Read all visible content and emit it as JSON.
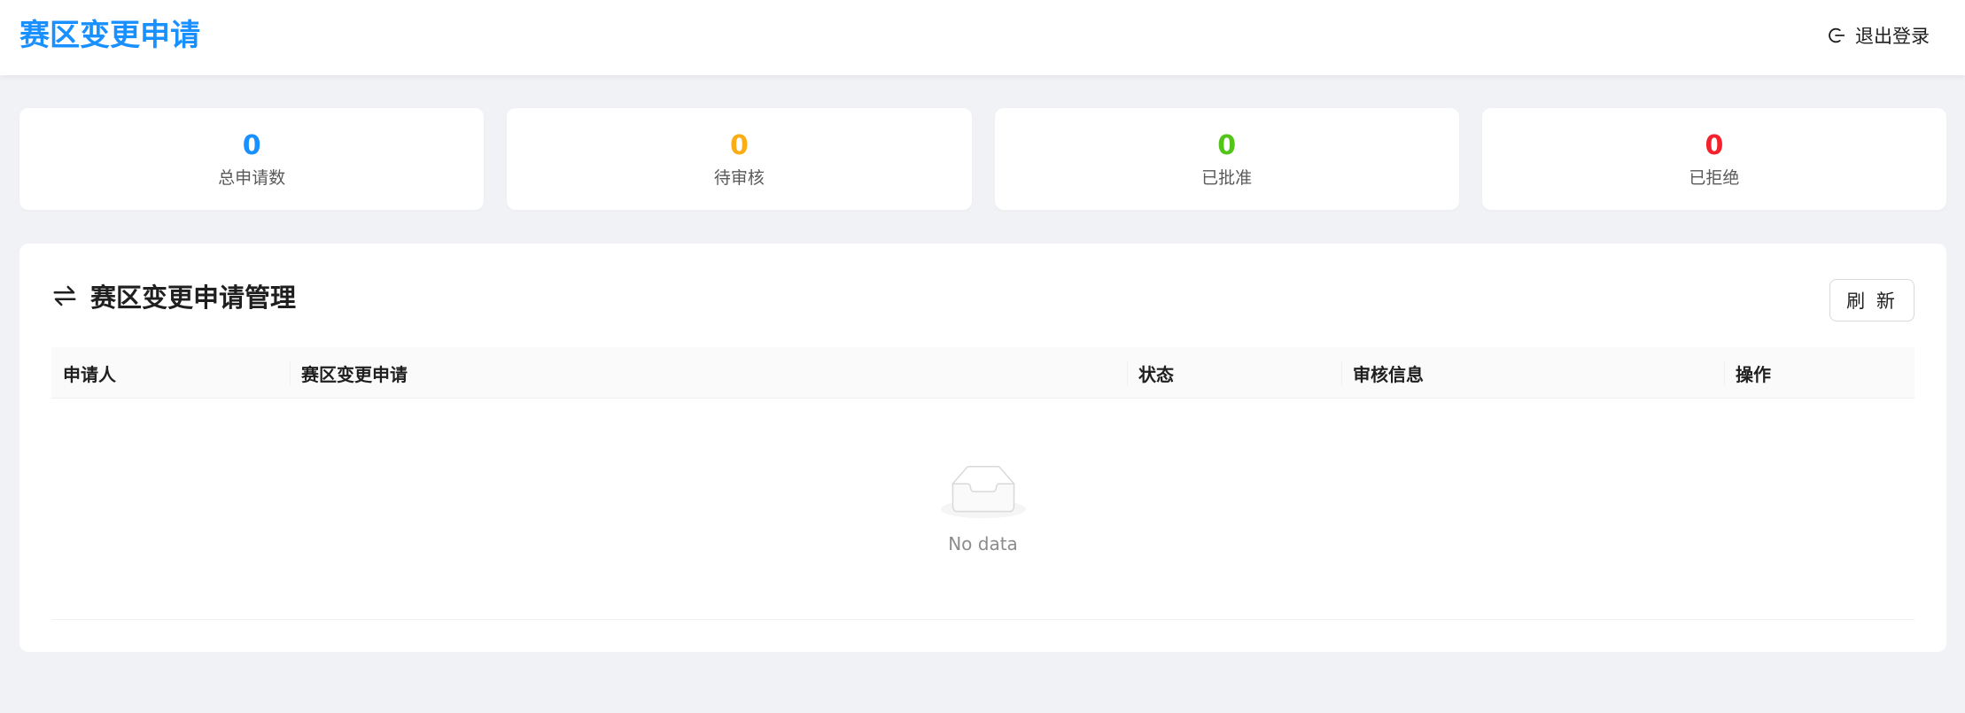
{
  "header": {
    "title": "赛区变更申请",
    "logout_label": "退出登录"
  },
  "colors": {
    "brand": "#1890ff",
    "pending": "#faad14",
    "approved": "#52c41a",
    "rejected": "#f5222d"
  },
  "stats": [
    {
      "value": "0",
      "label": "总申请数",
      "color": "#1890ff"
    },
    {
      "value": "0",
      "label": "待审核",
      "color": "#faad14"
    },
    {
      "value": "0",
      "label": "已批准",
      "color": "#52c41a"
    },
    {
      "value": "0",
      "label": "已拒绝",
      "color": "#f5222d"
    }
  ],
  "panel": {
    "title": "赛区变更申请管理",
    "title_icon": "swap-icon",
    "refresh_label": "刷 新"
  },
  "table": {
    "columns": [
      "申请人",
      "赛区变更申请",
      "状态",
      "审核信息",
      "操作"
    ],
    "rows": [],
    "empty_text": "No data"
  }
}
